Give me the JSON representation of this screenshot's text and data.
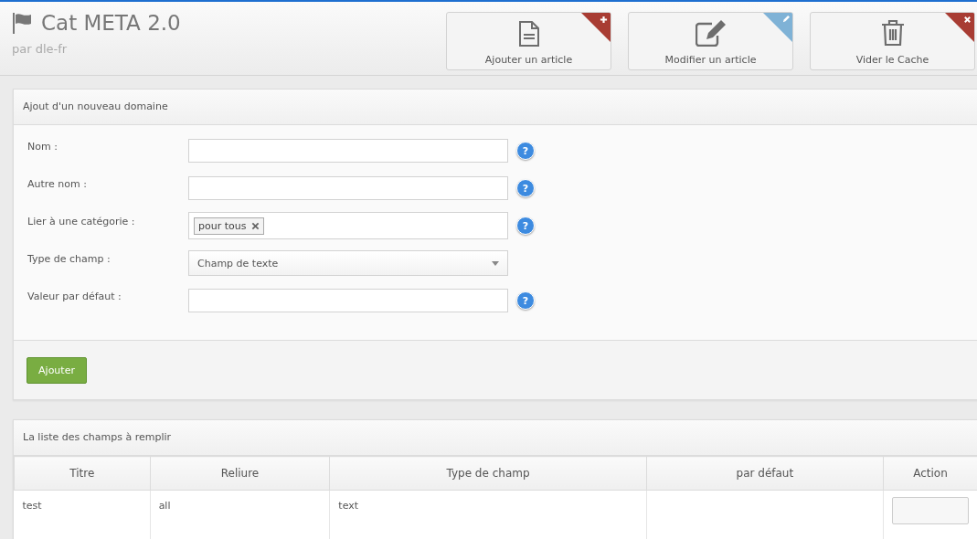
{
  "header": {
    "title": "Cat META 2.0",
    "subtitle": "par dle-fr"
  },
  "actions": [
    {
      "label": "Ajouter un article",
      "kind": "document",
      "badge": {
        "kind": "plus",
        "color": "#a83c33"
      }
    },
    {
      "label": "Modifier un article",
      "kind": "edit",
      "badge": {
        "kind": "pencil",
        "color": "#7fb2d6"
      }
    },
    {
      "label": "Vider le Cache",
      "kind": "trash",
      "badge": {
        "kind": "cross",
        "color": "#a83c33"
      }
    }
  ],
  "form": {
    "title": "Ajout d'un nouveau domaine",
    "fields": [
      {
        "kind": "text",
        "label": "Nom :",
        "help": "?"
      },
      {
        "kind": "text",
        "label": "Autre nom :",
        "help": "?"
      },
      {
        "kind": "tags",
        "label": "Lier à une catégorie :",
        "tags": [
          "pour tous"
        ],
        "help": "?"
      },
      {
        "kind": "select",
        "label": "Type de champ :",
        "value": "Champ de texte"
      },
      {
        "kind": "text",
        "label": "Valeur par défaut :",
        "help": "?"
      }
    ],
    "submit": "Ajouter"
  },
  "table": {
    "title": "La liste des champs à remplir",
    "columns": [
      "Titre",
      "Reliure",
      "Type de champ",
      "par défaut",
      "Action"
    ],
    "rows": [
      {
        "cells": [
          "test",
          "all",
          "text"
        ]
      }
    ]
  }
}
